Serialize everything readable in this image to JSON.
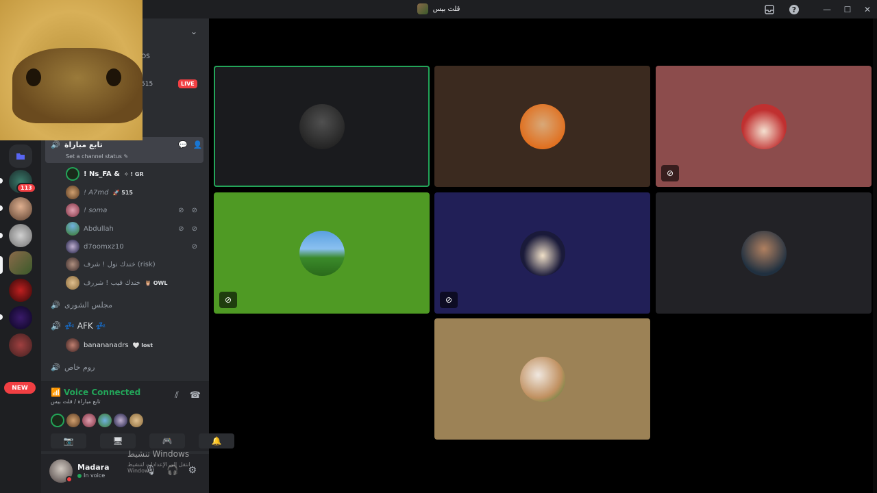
{
  "window": {
    "title": "قلت بيس",
    "controls": {
      "inbox_icon": "inbox-icon",
      "help_icon": "help-icon",
      "minimize": "—",
      "maximize": "☐",
      "close": "✕"
    }
  },
  "servers": {
    "badge_count": "113",
    "new_label": "NEW"
  },
  "channel_list": {
    "header_fragments": {
      "os": "OS",
      "num": "515"
    },
    "live_label": "LIVE",
    "active_channel": {
      "name": "تابع مباراة",
      "status_hint": "Set a channel status ✎"
    },
    "members": [
      {
        "name": "! Ns_FA &",
        "tag": "✧ ! GR",
        "bright": true,
        "icons": ""
      },
      {
        "name": "! A7md",
        "tag": "🚀 515",
        "bright": false,
        "icons": ""
      },
      {
        "name": "! soma",
        "tag": "",
        "bright": false,
        "icons": "⊘ ⊘"
      },
      {
        "name": "Abdullah",
        "tag": "",
        "bright": false,
        "icons": "⊘ ⊘"
      },
      {
        "name": "d7oomxz10",
        "tag": "",
        "bright": false,
        "icons": "⊘"
      },
      {
        "name": "خندك نول ! شرف (risk)",
        "tag": "",
        "bright": false,
        "icons": ""
      },
      {
        "name": "خندك فيب ! شررف",
        "tag": "🦉 OWL",
        "bright": false,
        "icons": ""
      }
    ],
    "other_channels": [
      {
        "name": "مجلس الشورى"
      },
      {
        "name": "💤 AFK 💤"
      }
    ],
    "afk_member": {
      "name": "banananadrs",
      "tag": "🤍 lost"
    },
    "last_channel": {
      "name": "روم خاص"
    }
  },
  "voice_panel": {
    "title": "Voice Connected",
    "subtitle": "تابع مباراة / قلت بيس",
    "buttons": [
      "camera-off-icon",
      "screen-share-icon",
      "activity-icon",
      "soundboard-icon"
    ]
  },
  "user_bar": {
    "username": "Madara",
    "status": "In voice"
  },
  "watermark": {
    "line1": "تنشيط Windows",
    "line2": "انتقل إلى الإعدادات لتنشيط Windows."
  },
  "tiles": [
    {
      "bg": "#1a1b1e",
      "speaking": true,
      "mark": ""
    },
    {
      "bg": "#3b2a1f",
      "speaking": false,
      "mark": ""
    },
    {
      "bg": "#8c4c4c",
      "speaking": false,
      "mark": "⊘"
    },
    {
      "bg": "#4f9a24",
      "speaking": false,
      "mark": "⊘"
    },
    {
      "bg": "#211f57",
      "speaking": false,
      "mark": "⊘"
    },
    {
      "bg": "#222226",
      "speaking": false,
      "mark": ""
    },
    {
      "bg": "#9c8256",
      "speaking": false,
      "mark": ""
    }
  ]
}
